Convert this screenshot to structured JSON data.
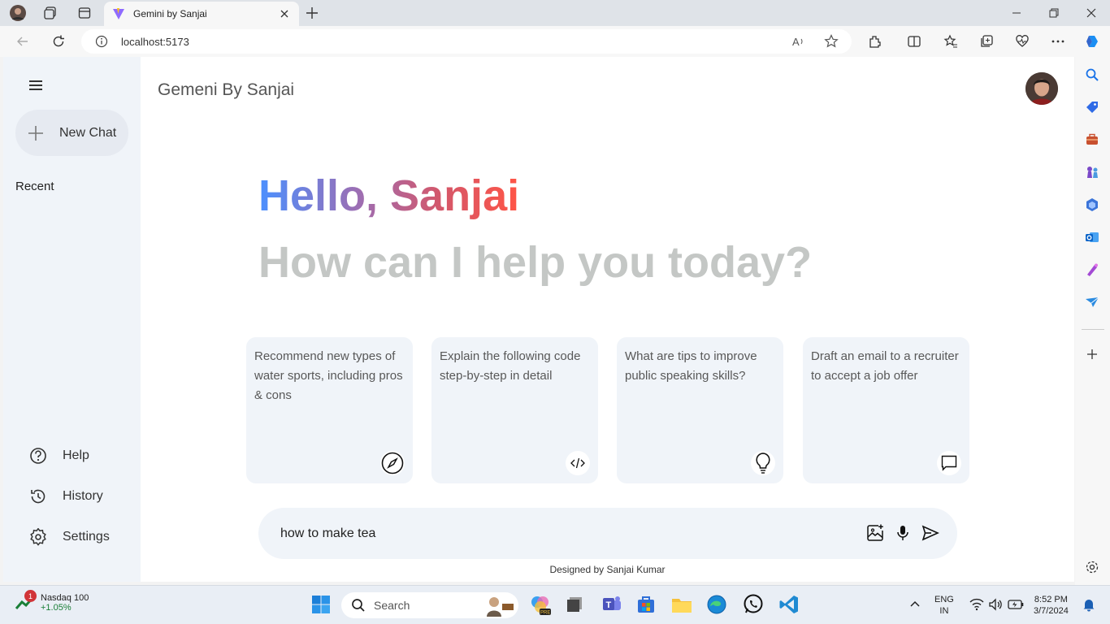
{
  "browser": {
    "tab_title": "Gemini by Sanjai",
    "url": "localhost:5173"
  },
  "app": {
    "brand": "Gemeni By Sanjai",
    "greeting": "Hello, Sanjai",
    "subtitle": "How can I help you today?",
    "footer": "Designed by Sanjai Kumar",
    "accent_colors": [
      "#4b90ff",
      "#ff5546"
    ]
  },
  "sidebar": {
    "new_chat_label": "New Chat",
    "recent_title": "Recent",
    "bottom_items": [
      {
        "label": "Help",
        "icon": "help-icon"
      },
      {
        "label": "History",
        "icon": "history-icon"
      },
      {
        "label": "Settings",
        "icon": "settings-icon"
      }
    ]
  },
  "cards": [
    {
      "text": "Recommend new types of water sports, including pros & cons",
      "icon": "compass-icon"
    },
    {
      "text": "Explain the following code step-by-step in detail",
      "icon": "code-icon"
    },
    {
      "text": "What are tips to improve public speaking skills?",
      "icon": "bulb-icon"
    },
    {
      "text": "Draft an email to a recruiter to accept a job offer",
      "icon": "message-icon"
    }
  ],
  "prompt": {
    "value": "how to make tea"
  },
  "taskbar": {
    "stock_name": "Nasdaq 100",
    "stock_change": "+1.05%",
    "notification_count": "1",
    "search_label": "Search",
    "lang_top": "ENG",
    "lang_bottom": "IN",
    "time": "8:52 PM",
    "date": "3/7/2024"
  }
}
